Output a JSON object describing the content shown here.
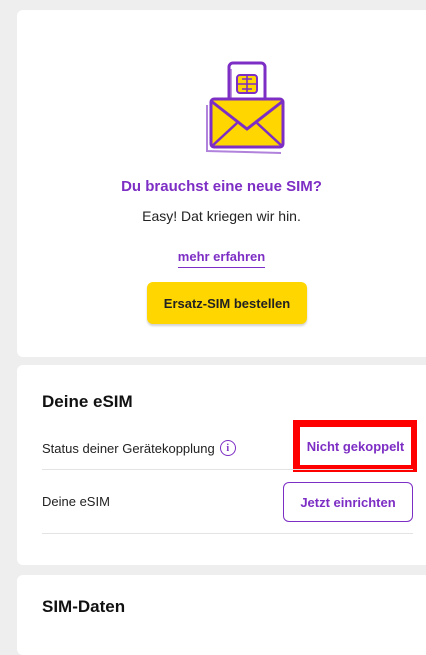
{
  "promo": {
    "title": "Du brauchst eine neue SIM?",
    "subtitle": "Easy! Dat kriegen wir hin.",
    "learn_more": "mehr erfahren",
    "order_button": "Ersatz-SIM bestellen",
    "illustration": "sim-card-envelope-icon"
  },
  "esim": {
    "title": "Deine eSIM",
    "status_label": "Status deiner Gerätekopplung",
    "status_info_icon": "info-icon",
    "status_value": "Nicht gekoppelt",
    "esim_label": "Deine eSIM",
    "setup_button": "Jetzt einrichten"
  },
  "sim_data": {
    "title": "SIM-Daten"
  },
  "colors": {
    "accent": "#7d2ec4",
    "brand_yellow": "#ffd600",
    "highlight": "#ff0000",
    "background": "#eeeeee"
  }
}
